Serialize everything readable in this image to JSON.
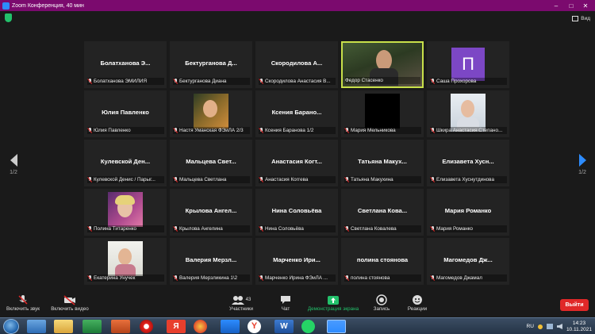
{
  "window": {
    "title": "Zoom Конференция, 40 мин",
    "view_label": "Вид"
  },
  "tiles": [
    {
      "big": "Болатханова Э...",
      "name": "Болатханова ЭМИЛИЯ"
    },
    {
      "big": "Бектурганова Д...",
      "name": "Бектурганова Диана"
    },
    {
      "big": "Скородилова А...",
      "name": "Скородилова Анастасия В..."
    },
    {
      "big": "",
      "name": "Федор Стасенко"
    },
    {
      "big": "",
      "name": "Саша Прохорова",
      "avatar_letter": "П"
    },
    {
      "big": "Юлия Павленко",
      "name": "Юлия Павленко"
    },
    {
      "big": "",
      "name": "Настя Уманская ФЭиЛА 2/3"
    },
    {
      "big": "Ксения Барано...",
      "name": "Ксения Баранова 1/2"
    },
    {
      "big": "",
      "name": "Мария Мельникова"
    },
    {
      "big": "",
      "name": "Шкира Анастасия Степано..."
    },
    {
      "big": "Кулевской Ден...",
      "name": "Кулевской Денис / Парыг..."
    },
    {
      "big": "Мальцева Свет...",
      "name": "Мальцева Светлана"
    },
    {
      "big": "Анастасия Когт...",
      "name": "Анастасия Коггева"
    },
    {
      "big": "Татьяна Макух...",
      "name": "Татьяна Макухина"
    },
    {
      "big": "Елизавета Хусн...",
      "name": "Елизавета Хуснутдинова"
    },
    {
      "big": "",
      "name": "Полина Титаренко"
    },
    {
      "big": "Крылова Ангел...",
      "name": "Крылова Ангелина"
    },
    {
      "big": "Нина Соловьёва",
      "name": "Нина Соловьёва"
    },
    {
      "big": "Светлана Кова...",
      "name": "Светлана Ковалева"
    },
    {
      "big": "Мария Романко",
      "name": "Мария Романко"
    },
    {
      "big": "",
      "name": "Екатерина Унучек"
    },
    {
      "big": "Валерия Мерзл...",
      "name": "Валерия Мерзликина 1\\2"
    },
    {
      "big": "Марченко Ири...",
      "name": "Марченко Ирина ФЭиЛА ..."
    },
    {
      "big": "полина стоянова",
      "name": "полина стоянова"
    },
    {
      "big": "Магомедов Дж...",
      "name": "Магомедов Джамал"
    }
  ],
  "pager": {
    "left": "1/2",
    "right": "1/2"
  },
  "toolbar": {
    "mute_label": "Включить звук",
    "video_label": "Включить видео",
    "participants_label": "Участники",
    "participants_count": "43",
    "chat_label": "Чат",
    "share_label": "Демонстрация экрана",
    "record_label": "Запись",
    "reactions_label": "Реакции",
    "leave_label": "Выйти"
  },
  "taskbar": {
    "lang": "RU",
    "time": "14:23",
    "date": "10.11.2021"
  },
  "colors": {
    "active_speaker": "#c8e04a",
    "share_green": "#23c16b",
    "leave_red": "#e02828",
    "accent_blue": "#2d8cff"
  }
}
